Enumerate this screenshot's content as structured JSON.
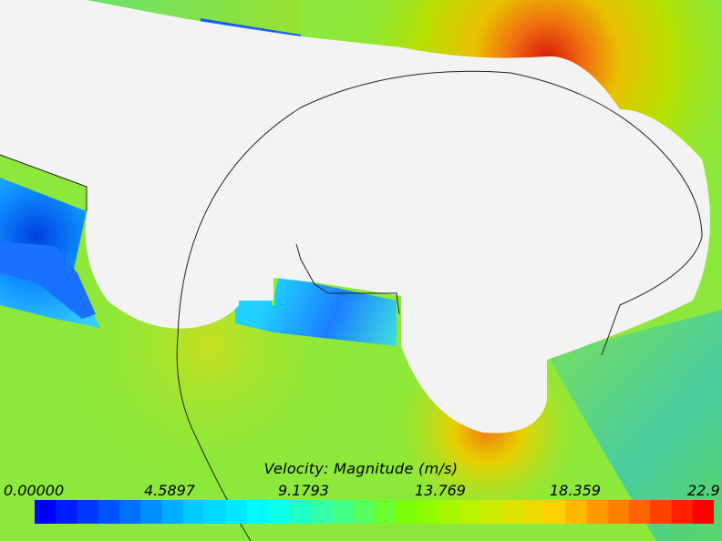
{
  "legend": {
    "title": "Velocity: Magnitude (m/s)",
    "ticks": [
      "0.00000",
      "4.5897",
      "9.1793",
      "13.769",
      "18.359",
      "22.9"
    ],
    "min": 0.0,
    "max": 22.9,
    "bands": 32,
    "colormap": [
      "#0000ff",
      "#0060ff",
      "#00c8ff",
      "#00ffff",
      "#40ff90",
      "#7fff00",
      "#c8f000",
      "#ffd000",
      "#ff7000",
      "#ff0000"
    ]
  },
  "field_colors": {
    "freestream": "#8ce83a",
    "wake": "#4fd0a0",
    "high_speed": "#e03010",
    "low_speed": "#0a4ae0",
    "solid": "#f3f3f3"
  }
}
